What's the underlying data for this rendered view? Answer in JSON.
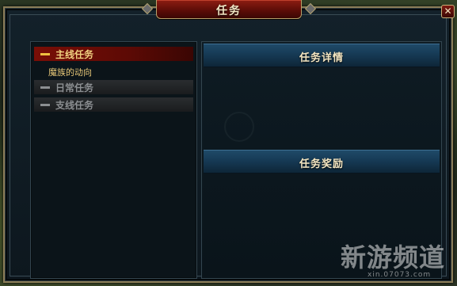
{
  "window": {
    "title": "任务",
    "close_glyph": "✕"
  },
  "quest_list": {
    "categories": [
      {
        "label": "主线任务",
        "active": true
      },
      {
        "label": "日常任务",
        "active": false
      },
      {
        "label": "支线任务",
        "active": false
      }
    ],
    "main_quest_item": "魔族的动向"
  },
  "details": {
    "details_header": "任务详情",
    "rewards_header": "任务奖励"
  },
  "watermark": {
    "main": "新游频道",
    "sub": "xin.07073.com"
  }
}
